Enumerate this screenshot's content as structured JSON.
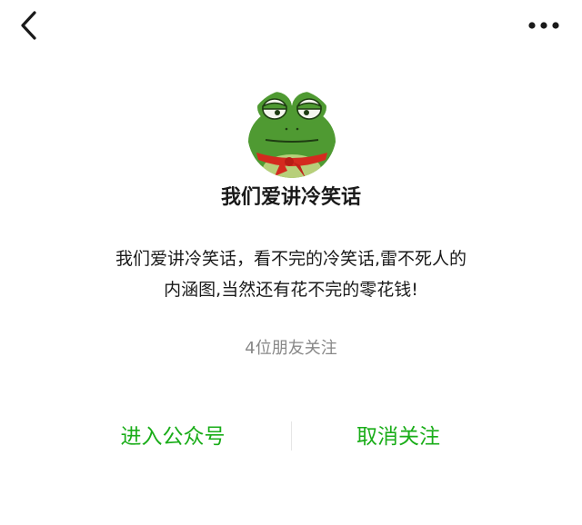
{
  "topbar": {
    "back_icon": "chevron-left-icon",
    "more_icon": "more-horizontal-icon"
  },
  "profile": {
    "avatar_icon": "frog-avatar",
    "name": "我们爱讲冷笑话",
    "description_line1": "我们爱讲冷笑话，看不完的冷笑话,雷不死人的",
    "description_line2": "内涵图,当然还有花不完的零花钱!",
    "followers": "4位朋友关注"
  },
  "actions": {
    "enter_label": "进入公众号",
    "unfollow_label": "取消关注"
  },
  "colors": {
    "accent": "#1aad19",
    "secondary_text": "#888888"
  }
}
